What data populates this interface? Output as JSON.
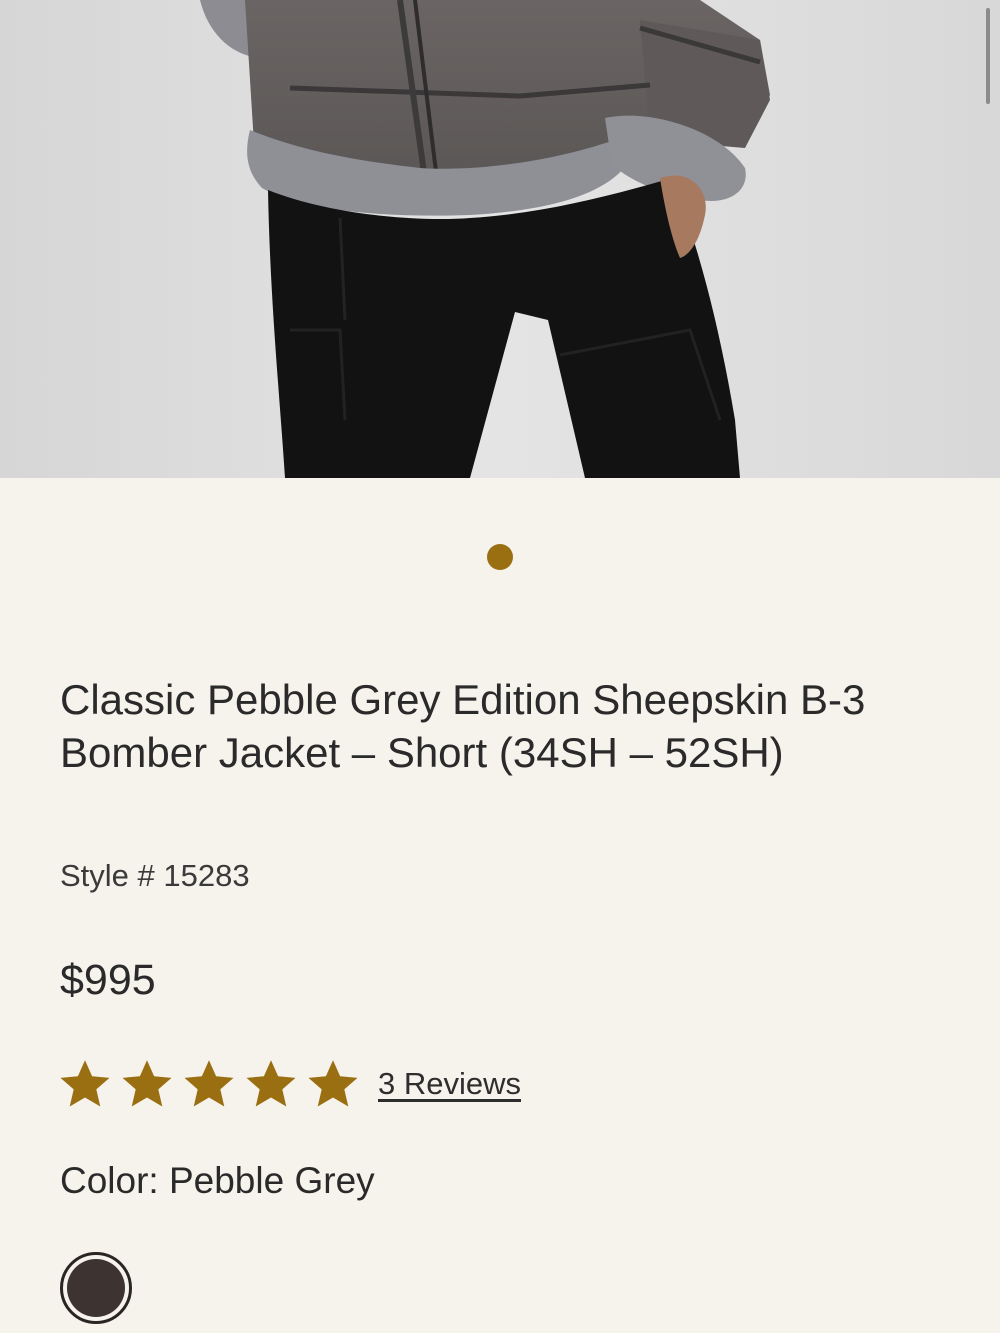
{
  "product": {
    "title": "Classic Pebble Grey Edition Sheepskin B-3 Bomber Jacket – Short (34SH – 52SH)",
    "style_number": "Style # 15283",
    "price": "$995",
    "rating": {
      "stars": 5,
      "max": 5,
      "reviews_label": "3 Reviews"
    },
    "color_label": "Color: Pebble Grey"
  },
  "gallery": {
    "image_count": 1,
    "active_index": 0,
    "image_icon": "product-photo"
  },
  "colors": {
    "accent": "#9a6f12",
    "background": "#f6f2ec",
    "text": "#2a2a2a",
    "swatch": "#3d3331"
  }
}
